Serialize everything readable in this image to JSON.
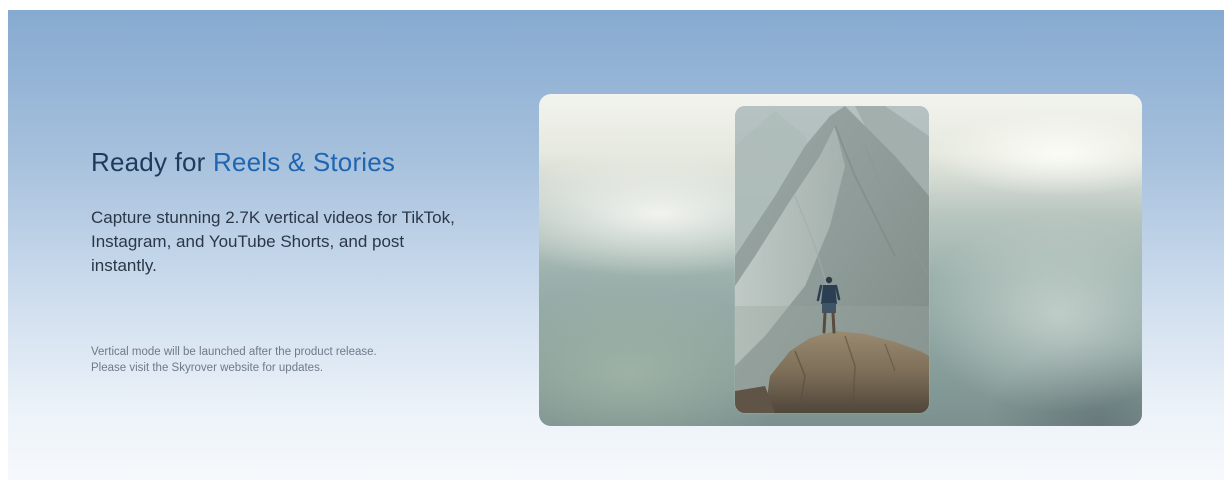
{
  "hero": {
    "headline_plain": "Ready for ",
    "headline_accent": "Reels & Stories",
    "description": "Capture stunning 2.7K vertical videos for TikTok, Instagram, and YouTube Shorts, and post instantly.",
    "footnote": "Vertical mode will be launched after the product release. Please visit the Skyrover website for updates."
  },
  "colors": {
    "headline_text": "#1e3a5c",
    "headline_accent": "#1f66b1",
    "body_text": "#2b3747",
    "footnote_text": "#6e7a88"
  }
}
